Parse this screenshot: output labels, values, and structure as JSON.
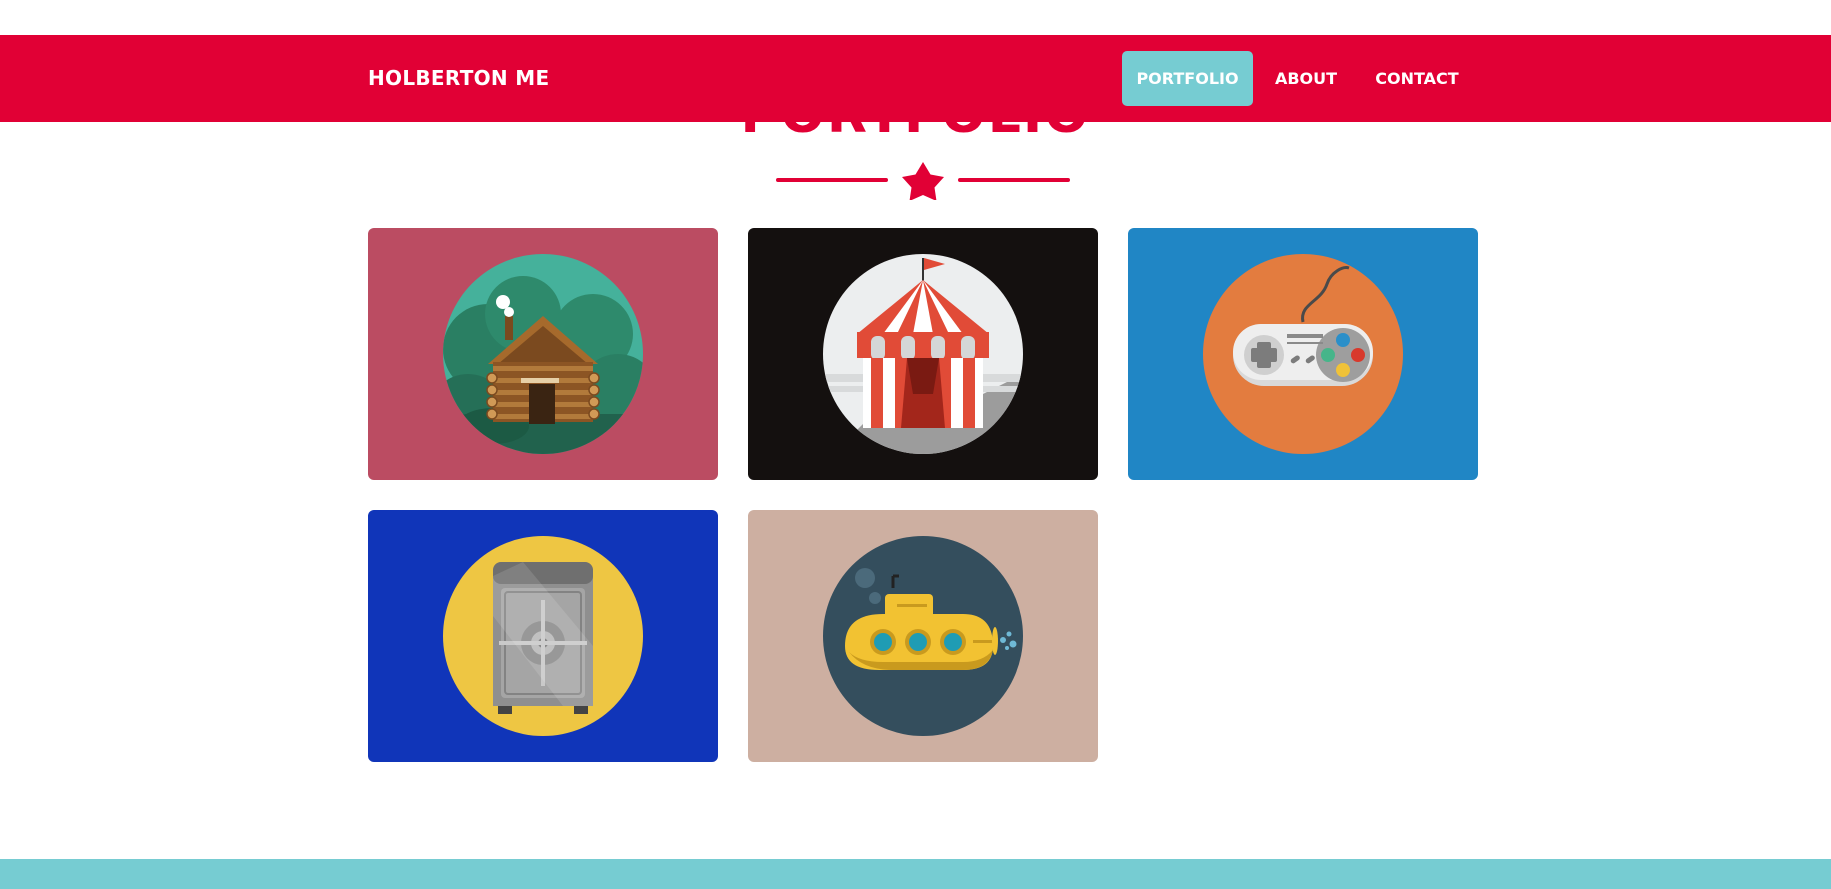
{
  "navbar": {
    "brand": "HOLBERTON ME",
    "items": [
      {
        "label": "PORTFOLIO",
        "active": true
      },
      {
        "label": "ABOUT",
        "active": false
      },
      {
        "label": "CONTACT",
        "active": false
      }
    ],
    "background": "#e10035",
    "active_background": "#76ccd2"
  },
  "section": {
    "title": "PORTFOLIO",
    "accent": "#e10035",
    "divider_icon": "star-icon"
  },
  "portfolio": {
    "tiles": [
      {
        "icon": "cabin-icon",
        "background": "#bb4c62",
        "circle": "#45b19b"
      },
      {
        "icon": "circus-tent-icon",
        "background": "#14100f",
        "circle": "#eceeef"
      },
      {
        "icon": "game-controller-icon",
        "background": "#2086c5",
        "circle": "#e37c3f"
      },
      {
        "icon": "safe-icon",
        "background": "#1035b9",
        "circle": "#eec643"
      },
      {
        "icon": "submarine-icon",
        "background": "#cdafa1",
        "circle": "#344e5d"
      }
    ]
  },
  "footer": {
    "background": "#76ccd2"
  }
}
